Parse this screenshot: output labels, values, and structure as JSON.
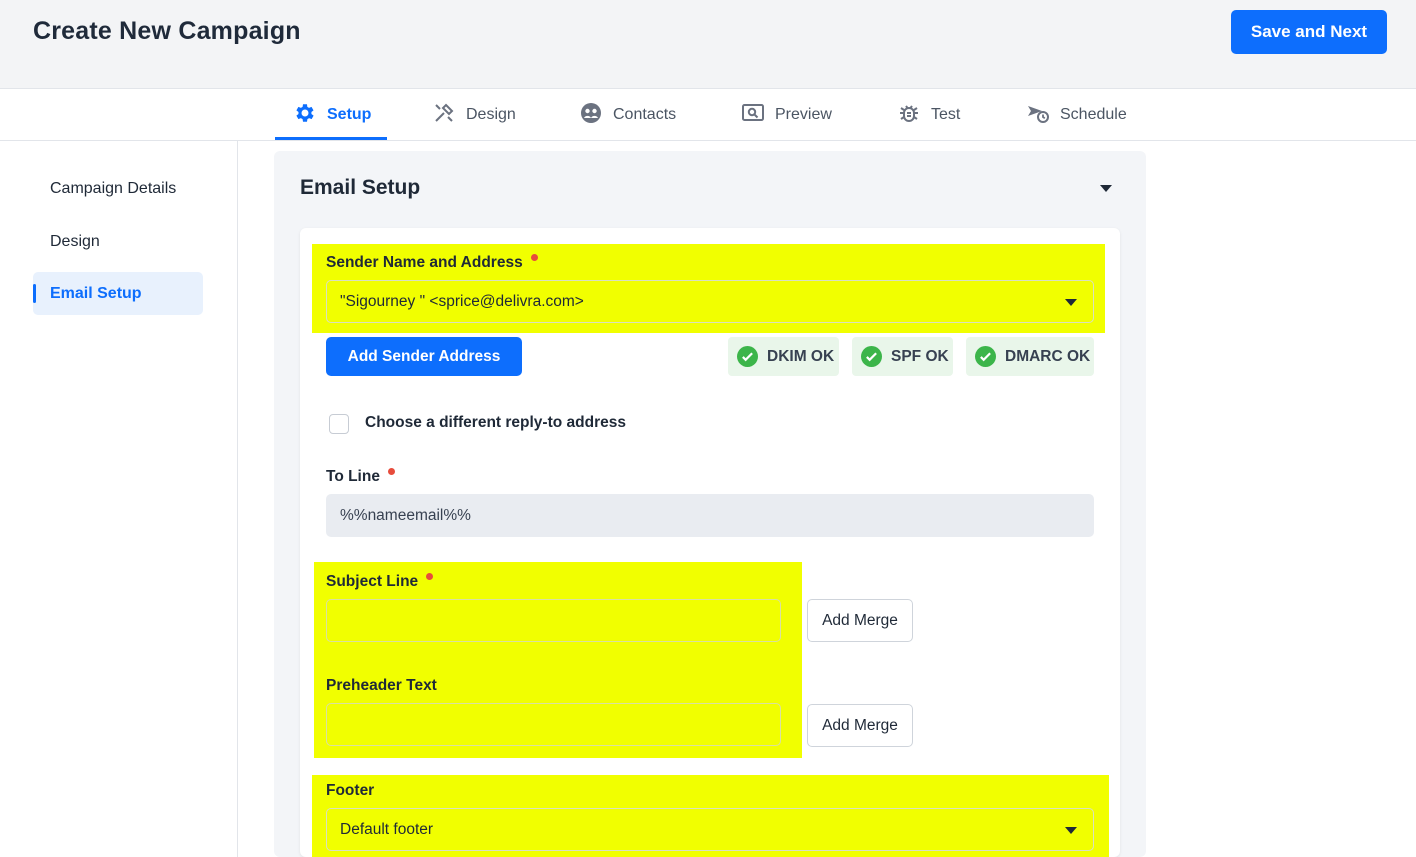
{
  "header": {
    "title": "Create New Campaign",
    "save_label": "Save and Next"
  },
  "tabs": [
    {
      "label": "Setup",
      "icon": "gear-icon",
      "active": true
    },
    {
      "label": "Design",
      "icon": "design-tools-icon",
      "active": false
    },
    {
      "label": "Contacts",
      "icon": "contacts-icon",
      "active": false
    },
    {
      "label": "Preview",
      "icon": "preview-icon",
      "active": false
    },
    {
      "label": "Test",
      "icon": "bug-icon",
      "active": false
    },
    {
      "label": "Schedule",
      "icon": "schedule-icon",
      "active": false
    }
  ],
  "sidebar": {
    "items": [
      {
        "label": "Campaign Details",
        "active": false
      },
      {
        "label": "Design",
        "active": false
      },
      {
        "label": "Email Setup",
        "active": true
      }
    ]
  },
  "panel": {
    "title": "Email Setup"
  },
  "sender": {
    "label": "Sender Name and Address",
    "value": "\"Sigourney \" <sprice@delivra.com>",
    "add_button": "Add Sender Address"
  },
  "auth_badges": [
    {
      "label": "DKIM OK"
    },
    {
      "label": "SPF OK"
    },
    {
      "label": "DMARC OK"
    }
  ],
  "reply_to": {
    "label": "Choose a different reply-to address",
    "checked": false
  },
  "to_line": {
    "label": "To Line",
    "value": "%%nameemail%%"
  },
  "subject": {
    "label": "Subject Line",
    "value": "",
    "merge_label": "Add Merge"
  },
  "preheader": {
    "label": "Preheader Text",
    "value": "",
    "merge_label": "Add Merge"
  },
  "footer": {
    "label": "Footer",
    "value": "Default footer"
  },
  "colors": {
    "accent": "#0d6efd",
    "highlight": "#f1ff00",
    "required": "#e74c3c",
    "ok": "#3cb54a"
  }
}
